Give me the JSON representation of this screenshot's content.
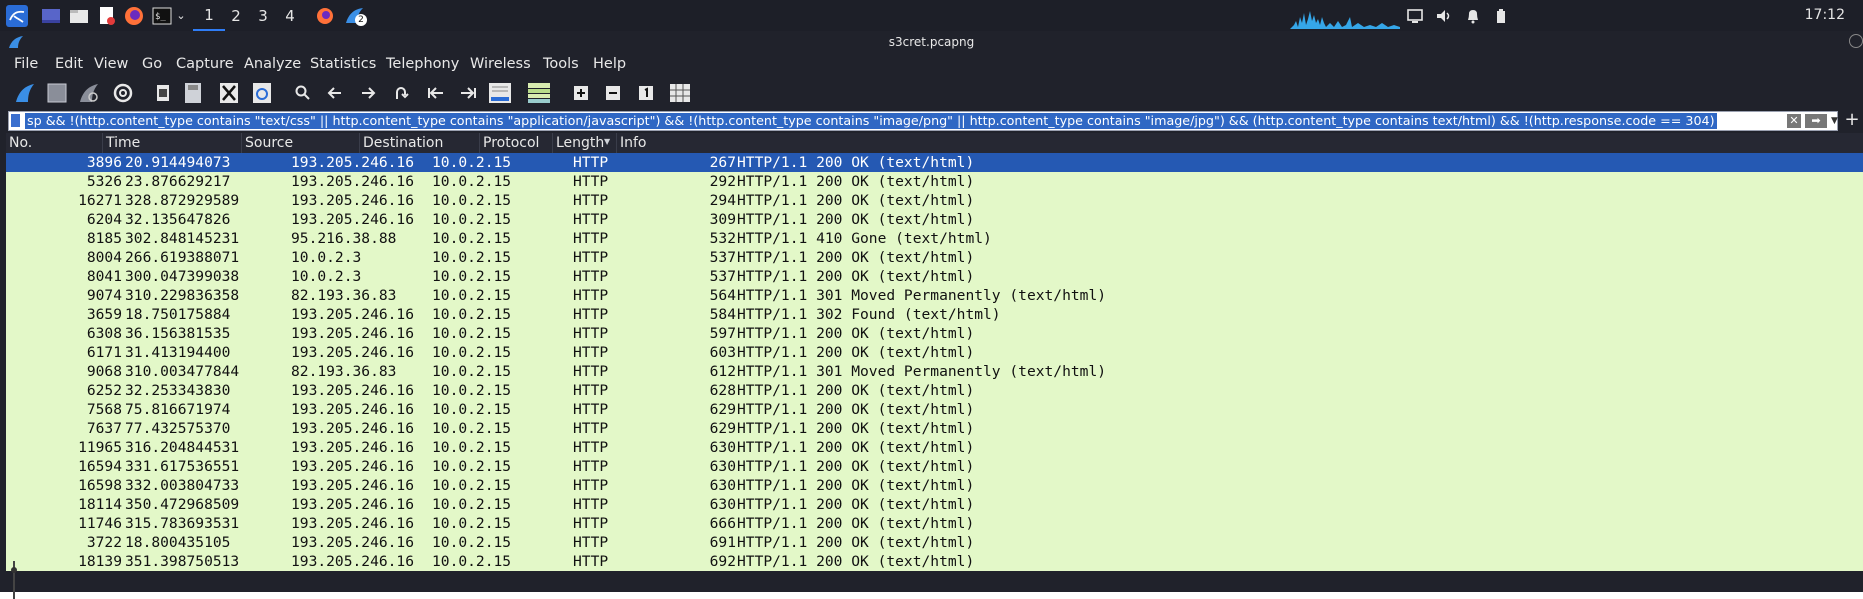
{
  "taskbar": {
    "workspaces": [
      "1",
      "2",
      "3",
      "4"
    ],
    "active_workspace": "1",
    "badge": "2",
    "clock": "17:12"
  },
  "window": {
    "title": "s3cret.pcapng"
  },
  "menu": [
    "File",
    "Edit",
    "View",
    "Go",
    "Capture",
    "Analyze",
    "Statistics",
    "Telephony",
    "Wireless",
    "Tools",
    "Help"
  ],
  "toolbar": {
    "icons": [
      "shark-fin-start-icon",
      "stop-icon",
      "restart-icon",
      "options-gear-icon",
      "open-file-icon",
      "save-file-icon",
      "close-file-icon",
      "reload-icon",
      "find-icon",
      "back-arrow-icon",
      "forward-arrow-icon",
      "goto-packet-icon",
      "first-packet-icon",
      "last-packet-icon",
      "autoscroll-icon",
      "colorize-icon",
      "zoom-in-icon",
      "zoom-out-icon",
      "normal-size-icon",
      "resize-columns-icon"
    ]
  },
  "filter": {
    "value": "sp  && !(http.content_type contains \"text/css\" || http.content_type contains \"application/javascript\") && !(http.content_type contains \"image/png\" || http.content_type contains \"image/jpg\") && (http.content_type contains text/html) && !(http.response.code == 304)"
  },
  "columns": [
    "No.",
    "Time",
    "Source",
    "Destination",
    "Protocol",
    "Length",
    "Info"
  ],
  "rows": [
    {
      "no": "3896",
      "time": "20.914494073",
      "src": "193.205.246.16",
      "dst": "10.0.2.15",
      "proto": "HTTP",
      "len": "267",
      "info": "HTTP/1.1 200 OK  (text/html)"
    },
    {
      "no": "5326",
      "time": "23.876629217",
      "src": "193.205.246.16",
      "dst": "10.0.2.15",
      "proto": "HTTP",
      "len": "292",
      "info": "HTTP/1.1 200 OK  (text/html)"
    },
    {
      "no": "16271",
      "time": "328.872929589",
      "src": "193.205.246.16",
      "dst": "10.0.2.15",
      "proto": "HTTP",
      "len": "294",
      "info": "HTTP/1.1 200 OK  (text/html)"
    },
    {
      "no": "6204",
      "time": "32.135647826",
      "src": "193.205.246.16",
      "dst": "10.0.2.15",
      "proto": "HTTP",
      "len": "309",
      "info": "HTTP/1.1 200 OK  (text/html)"
    },
    {
      "no": "8185",
      "time": "302.848145231",
      "src": "95.216.38.88",
      "dst": "10.0.2.15",
      "proto": "HTTP",
      "len": "532",
      "info": "HTTP/1.1 410 Gone  (text/html)"
    },
    {
      "no": "8004",
      "time": "266.619388071",
      "src": "10.0.2.3",
      "dst": "10.0.2.15",
      "proto": "HTTP",
      "len": "537",
      "info": "HTTP/1.1 200 OK  (text/html)"
    },
    {
      "no": "8041",
      "time": "300.047399038",
      "src": "10.0.2.3",
      "dst": "10.0.2.15",
      "proto": "HTTP",
      "len": "537",
      "info": "HTTP/1.1 200 OK  (text/html)"
    },
    {
      "no": "9074",
      "time": "310.229836358",
      "src": "82.193.36.83",
      "dst": "10.0.2.15",
      "proto": "HTTP",
      "len": "564",
      "info": "HTTP/1.1 301 Moved Permanently  (text/html)"
    },
    {
      "no": "3659",
      "time": "18.750175884",
      "src": "193.205.246.16",
      "dst": "10.0.2.15",
      "proto": "HTTP",
      "len": "584",
      "info": "HTTP/1.1 302 Found  (text/html)"
    },
    {
      "no": "6308",
      "time": "36.156381535",
      "src": "193.205.246.16",
      "dst": "10.0.2.15",
      "proto": "HTTP",
      "len": "597",
      "info": "HTTP/1.1 200 OK  (text/html)"
    },
    {
      "no": "6171",
      "time": "31.413194400",
      "src": "193.205.246.16",
      "dst": "10.0.2.15",
      "proto": "HTTP",
      "len": "603",
      "info": "HTTP/1.1 200 OK  (text/html)"
    },
    {
      "no": "9068",
      "time": "310.003477844",
      "src": "82.193.36.83",
      "dst": "10.0.2.15",
      "proto": "HTTP",
      "len": "612",
      "info": "HTTP/1.1 301 Moved Permanently  (text/html)"
    },
    {
      "no": "6252",
      "time": "32.253343830",
      "src": "193.205.246.16",
      "dst": "10.0.2.15",
      "proto": "HTTP",
      "len": "628",
      "info": "HTTP/1.1 200 OK  (text/html)"
    },
    {
      "no": "7568",
      "time": "75.816671974",
      "src": "193.205.246.16",
      "dst": "10.0.2.15",
      "proto": "HTTP",
      "len": "629",
      "info": "HTTP/1.1 200 OK  (text/html)"
    },
    {
      "no": "7637",
      "time": "77.432575370",
      "src": "193.205.246.16",
      "dst": "10.0.2.15",
      "proto": "HTTP",
      "len": "629",
      "info": "HTTP/1.1 200 OK  (text/html)"
    },
    {
      "no": "11965",
      "time": "316.204844531",
      "src": "193.205.246.16",
      "dst": "10.0.2.15",
      "proto": "HTTP",
      "len": "630",
      "info": "HTTP/1.1 200 OK  (text/html)"
    },
    {
      "no": "16594",
      "time": "331.617536551",
      "src": "193.205.246.16",
      "dst": "10.0.2.15",
      "proto": "HTTP",
      "len": "630",
      "info": "HTTP/1.1 200 OK  (text/html)"
    },
    {
      "no": "16598",
      "time": "332.003804733",
      "src": "193.205.246.16",
      "dst": "10.0.2.15",
      "proto": "HTTP",
      "len": "630",
      "info": "HTTP/1.1 200 OK  (text/html)"
    },
    {
      "no": "18114",
      "time": "350.472968509",
      "src": "193.205.246.16",
      "dst": "10.0.2.15",
      "proto": "HTTP",
      "len": "630",
      "info": "HTTP/1.1 200 OK  (text/html)"
    },
    {
      "no": "11746",
      "time": "315.783693531",
      "src": "193.205.246.16",
      "dst": "10.0.2.15",
      "proto": "HTTP",
      "len": "666",
      "info": "HTTP/1.1 200 OK  (text/html)"
    },
    {
      "no": "3722",
      "time": "18.800435105",
      "src": "193.205.246.16",
      "dst": "10.0.2.15",
      "proto": "HTTP",
      "len": "691",
      "info": "HTTP/1.1 200 OK  (text/html)"
    },
    {
      "no": "18139",
      "time": "351.398750513",
      "src": "193.205.246.16",
      "dst": "10.0.2.15",
      "proto": "HTTP",
      "len": "692",
      "info": "HTTP/1.1 200 OK  (text/html)"
    }
  ],
  "selected_row": 0,
  "colors": {
    "row_bg": "#e3f8c8",
    "selected_bg": "#2559b3",
    "chrome_bg": "#20222b",
    "accent": "#2f7df6"
  }
}
